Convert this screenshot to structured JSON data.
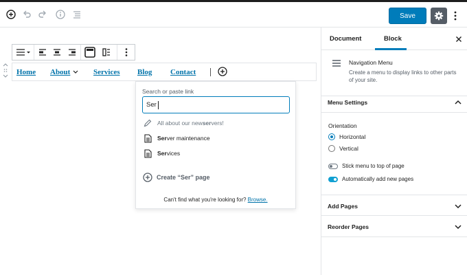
{
  "header": {
    "save_label": "Save",
    "icons": [
      "add-block-icon",
      "undo-icon",
      "redo-icon",
      "info-icon",
      "outline-icon",
      "gear-icon",
      "more-vertical-icon"
    ]
  },
  "toolbar": {
    "icons": [
      "menu-icon",
      "chevron-down-icon",
      "justify-left-icon",
      "justify-center-icon",
      "justify-right-icon",
      "navigation-icon",
      "block-layout-icon",
      "more-vertical-icon"
    ]
  },
  "navigation": {
    "items": [
      "Home",
      "About",
      "Services",
      "Blog",
      "Contact"
    ]
  },
  "link_popover": {
    "label": "Search or paste link",
    "input_value": "Ser",
    "suggestions": [
      {
        "prefix": "All about our new ",
        "match": "ser",
        "suffix": "vers!",
        "icon": "pencil-icon"
      },
      {
        "prefix": "",
        "match": "Ser",
        "suffix": "ver maintenance",
        "icon": "page-icon"
      },
      {
        "prefix": "",
        "match": "Ser",
        "suffix": "vices",
        "icon": "page-icon"
      }
    ],
    "create_label": "Create “Ser” page",
    "footer_text": "Can't find what you're looking for?",
    "footer_link": "Browse."
  },
  "sidebar": {
    "tabs": [
      "Document",
      "Block"
    ],
    "active_tab": "Block",
    "block_card": {
      "title": "Navigation Menu",
      "description": "Create a menu to display links to other parts of your site."
    },
    "panels": {
      "menu_settings": "Menu Settings",
      "add_pages": "Add Pages",
      "reorder_pages": "Reorder Pages"
    },
    "orientation": {
      "label": "Orientation",
      "options": [
        "Horizontal",
        "Vertical"
      ],
      "selected": "Horizontal"
    },
    "toggles": [
      {
        "label": "Stick menu to top of page",
        "on": false
      },
      {
        "label": "Automatically add new pages",
        "on": true
      }
    ]
  },
  "colors": {
    "accent": "#007cba",
    "link": "#0073aa",
    "toggle_on": "#11a0d2"
  }
}
